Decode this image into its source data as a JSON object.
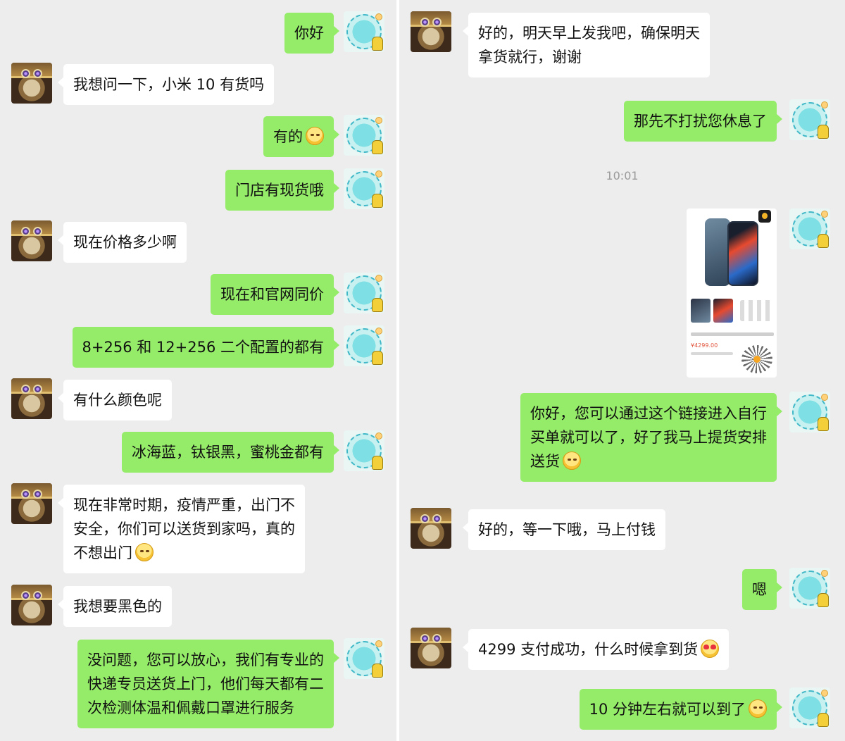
{
  "left_pane": {
    "messages": [
      {
        "side": "out",
        "lines": [
          "你好"
        ]
      },
      {
        "side": "in",
        "lines": [
          "我想问一下，小米 10 有货吗"
        ]
      },
      {
        "side": "out",
        "lines": [
          "有的"
        ],
        "emoji": "smile-emoji"
      },
      {
        "side": "out",
        "lines": [
          "门店有现货哦"
        ]
      },
      {
        "side": "in",
        "lines": [
          "现在价格多少啊"
        ]
      },
      {
        "side": "out",
        "lines": [
          "现在和官网同价"
        ]
      },
      {
        "side": "out",
        "lines": [
          "8+256 和 12+256 二个配置的都有"
        ]
      },
      {
        "side": "in",
        "lines": [
          "有什么颜色呢"
        ]
      },
      {
        "side": "out",
        "lines": [
          "冰海蓝，钛银黑，蜜桃金都有"
        ]
      },
      {
        "side": "in",
        "lines": [
          "现在非常时期，疫情严重，出门不",
          "安全，你们可以送货到家吗，真的",
          "不想出门"
        ],
        "emoji": "blush-emoji"
      },
      {
        "side": "in",
        "lines": [
          "我想要黑色的"
        ]
      },
      {
        "side": "out",
        "lines": [
          "没问题，您可以放心，我们有专业的",
          "快递专员送货上门，他们每天都有二",
          "次检测体温和佩戴口罩进行服务"
        ]
      }
    ]
  },
  "right_pane": {
    "messages": [
      {
        "side": "in",
        "lines": [
          "好的，明天早上发我吧，确保明天",
          "拿货就行，谢谢"
        ]
      },
      {
        "side": "out",
        "lines": [
          "那先不打扰您休息了"
        ]
      },
      {
        "side": "out",
        "lines": [
          "你好，您可以通过这个链接进入自行",
          "买单就可以了，好了我马上提货安排",
          "送货"
        ],
        "emoji": "smile-emoji"
      },
      {
        "side": "in",
        "lines": [
          "好的，等一下哦，马上付钱"
        ]
      },
      {
        "side": "out",
        "lines": [
          "嗯"
        ]
      },
      {
        "side": "in",
        "lines": [
          "4299 支付成功，什么时候拿到货"
        ],
        "emoji": "heart-eyes-emoji"
      },
      {
        "side": "out",
        "lines": [
          "10 分钟左右就可以到了"
        ],
        "emoji": "smile-emoji"
      }
    ],
    "timestamp": "10:01",
    "product_card": {
      "price": "¥4299.00",
      "colors": {
        "accent": "#e0533a",
        "badge": "#f3b428"
      }
    }
  },
  "colors": {
    "chat_background": "#ededed",
    "outgoing_bubble": "#95ec69",
    "incoming_bubble": "#ffffff",
    "timestamp_text": "#9a9a9a"
  }
}
